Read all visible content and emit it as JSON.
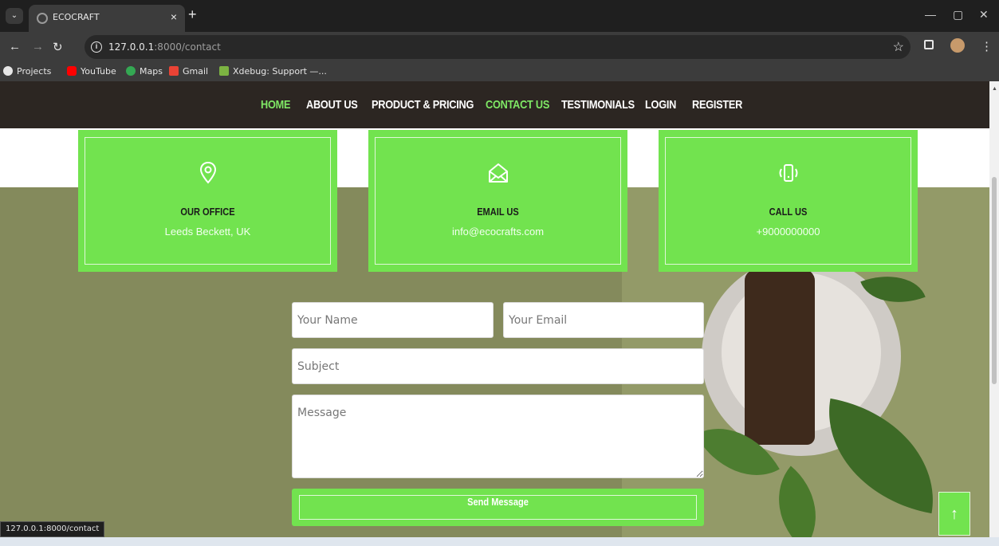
{
  "browser": {
    "tab_title": "ECOCRAFT",
    "tab_close": "×",
    "new_tab": "+",
    "url_host": "127.0.0.1",
    "url_path": ":8000/contact",
    "status_url": "127.0.0.1:8000/contact",
    "bookmarks": [
      {
        "label": "Projects",
        "icon": "globe-icon",
        "color": "#e6e6e6"
      },
      {
        "label": "YouTube",
        "icon": "youtube-icon",
        "color": "#ff0000"
      },
      {
        "label": "Maps",
        "icon": "maps-icon",
        "color": "#34a853"
      },
      {
        "label": "Gmail",
        "icon": "gmail-icon",
        "color": "#ea4335"
      },
      {
        "label": "Xdebug: Support —...",
        "icon": "xdebug-icon",
        "color": "#7cb342"
      }
    ]
  },
  "nav": {
    "items": [
      {
        "label": "HOME",
        "active": true
      },
      {
        "label": "ABOUT US",
        "active": false
      },
      {
        "label": "PRODUCT & PRICING",
        "active": false
      },
      {
        "label": "CONTACT US",
        "active": true
      },
      {
        "label": "TESTIMONIALS",
        "active": false
      },
      {
        "label": "LOGIN",
        "active": false
      },
      {
        "label": "REGISTER",
        "active": false
      }
    ]
  },
  "contact_cards": [
    {
      "icon": "location-pin-icon",
      "title": "OUR OFFICE",
      "text": "Leeds Beckett, UK"
    },
    {
      "icon": "envelope-icon",
      "title": "EMAIL US",
      "text": "info@ecocrafts.com"
    },
    {
      "icon": "phone-vibrate-icon",
      "title": "CALL US",
      "text": "+9000000000"
    }
  ],
  "form": {
    "name_placeholder": "Your Name",
    "email_placeholder": "Your Email",
    "subject_placeholder": "Subject",
    "message_placeholder": "Message",
    "submit_label": "Send Message"
  },
  "back_to_top": "↑",
  "colors": {
    "accent": "#72e34f",
    "nav_bg": "#2c2622",
    "nav_active": "#7fe865",
    "hero_bg": "#848a5c"
  }
}
